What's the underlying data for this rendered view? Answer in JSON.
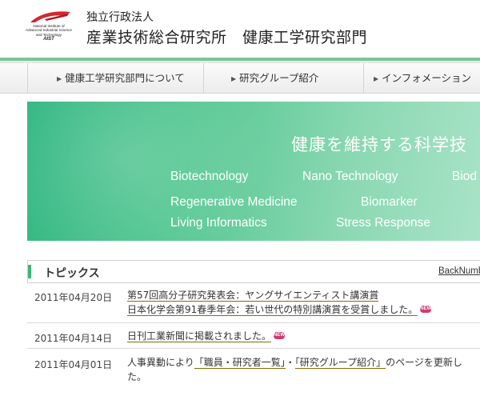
{
  "header": {
    "logo": {
      "line1": "National Institute of",
      "line2": "Advanced Industrial Science",
      "line3": "and Technology",
      "abbr": "AIST"
    },
    "org_small": "独立行政法人",
    "org_big": "産業技術総合研究所　健康工学研究部門"
  },
  "nav": {
    "items": [
      {
        "label": "健康工学研究部門について"
      },
      {
        "label": "研究グループ紹介"
      },
      {
        "label": "インフォメーション"
      }
    ]
  },
  "hero": {
    "title": "健康を維持する科学技",
    "tags": [
      "Biotechnology",
      "Nano Technology",
      "Biod",
      "Regenerative Medicine",
      "Biomarker",
      "Living Informatics",
      "Stress Response"
    ]
  },
  "topics": {
    "title": "トピックス",
    "back_link": "BackNumb",
    "items": [
      {
        "date": "2011年04月20日",
        "line1": "第57回高分子研究発表会：ヤングサイエンティスト講演賞",
        "line2": "日本化学会第91春季年会：若い世代の特別講演賞を受賞しました。",
        "badge": "NEW"
      },
      {
        "date": "2011年04月14日",
        "line1": "日刊工業新聞に掲載されました。",
        "badge": "NEW"
      },
      {
        "date": "2011年04月01日",
        "pre": "人事異動により",
        "link1": "「職員・研究者一覧」",
        "sep": "・",
        "link2": "「研究グループ紹介」",
        "post": "のページを更新し",
        "line2": "た。"
      }
    ]
  },
  "colors": {
    "accent_green": "#3bb57a",
    "badge_red": "#d23a6a",
    "header_rule": "#7cc598"
  }
}
